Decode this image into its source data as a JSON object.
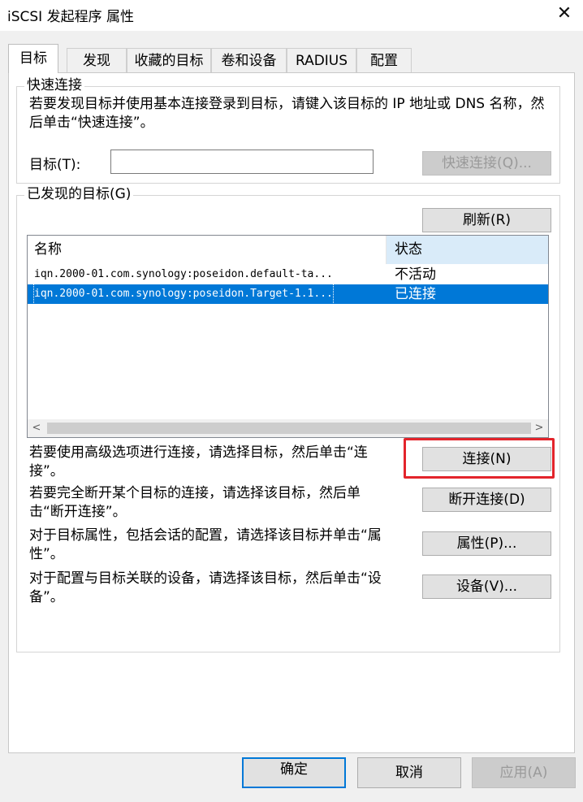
{
  "window": {
    "title": "iSCSI 发起程序 属性",
    "close_glyph": "✕"
  },
  "tabs": [
    "目标",
    "发现",
    "收藏的目标",
    "卷和设备",
    "RADIUS",
    "配置"
  ],
  "quick_connect": {
    "legend": "快速连接",
    "description": "若要发现目标并使用基本连接登录到目标，请键入该目标的 IP 地址或 DNS 名称，然后单击“快速连接”。",
    "target_label": "目标(T):",
    "target_value": "",
    "button": "快速连接(Q)..."
  },
  "discovered": {
    "legend": "已发现的目标(G)",
    "refresh_button": "刷新(R)",
    "columns": [
      "名称",
      "状态"
    ],
    "rows": [
      {
        "name": "iqn.2000-01.com.synology:poseidon.default-ta...",
        "status": "不活动"
      },
      {
        "name": "iqn.2000-01.com.synology:poseidon.Target-1.1...",
        "status": "已连接"
      }
    ],
    "scroll_left": "<",
    "scroll_right": ">"
  },
  "actions": [
    {
      "text": "若要使用高级选项进行连接，请选择目标，然后单击“连接”。",
      "button": "连接(N)"
    },
    {
      "text": "若要完全断开某个目标的连接，请选择该目标，然后单击“断开连接”。",
      "button": "断开连接(D)"
    },
    {
      "text": "对于目标属性，包括会话的配置，请选择该目标并单击“属性”。",
      "button": "属性(P)..."
    },
    {
      "text": "对于配置与目标关联的设备，请选择该目标，然后单击“设备”。",
      "button": "设备(V)..."
    }
  ],
  "footer": {
    "ok": "确定",
    "cancel": "取消",
    "apply": "应用(A)"
  },
  "colors": {
    "accent": "#0078d7",
    "highlight": "#e3242b",
    "dialog_bg": "#f0f0f0"
  }
}
